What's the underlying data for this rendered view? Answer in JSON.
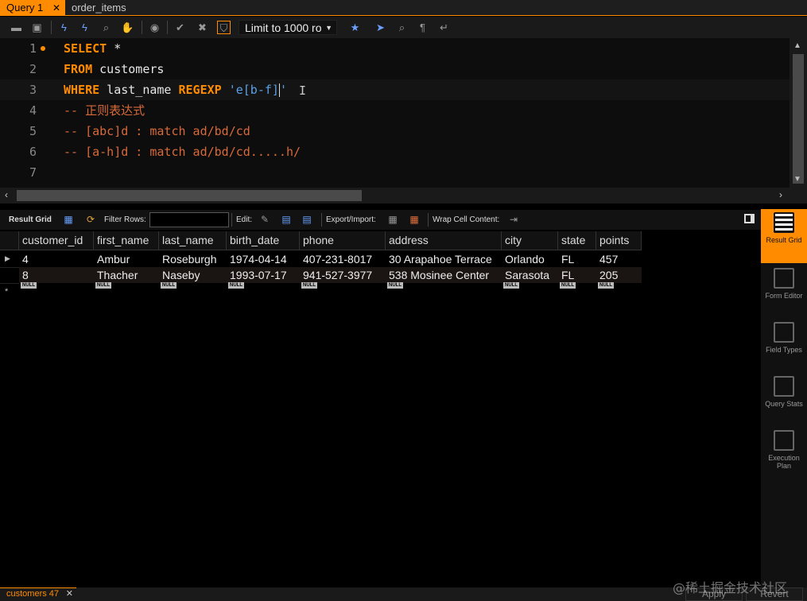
{
  "tabs": [
    {
      "label": "Query 1",
      "active": true
    },
    {
      "label": "order_items",
      "active": false
    }
  ],
  "toolbar": {
    "limit_label": "Limit to 1000 ro",
    "icons": [
      "open-folder-icon",
      "save-icon",
      "execute-icon",
      "execute-selection-icon",
      "explain-icon",
      "stop-icon",
      "toggle-autocommit-icon",
      "commit-icon",
      "rollback-icon",
      "toggle-error-icon",
      "bookmark-star-icon",
      "beautify-icon",
      "find-icon",
      "invisible-chars-icon",
      "wrap-icon"
    ]
  },
  "editor": {
    "line_numbers": [
      "1",
      "2",
      "3",
      "4",
      "5",
      "6",
      "7"
    ],
    "lines": [
      {
        "kw": "SELECT",
        "rest": " *"
      },
      {
        "kw": "FROM",
        "rest": " customers"
      },
      {
        "kw": "WHERE",
        "rest": " last_name ",
        "kw2": "REGEXP",
        "str": " 'e[b-f]",
        "str2": "'"
      },
      {
        "comment": "-- 正则表达式"
      },
      {
        "comment": "-- [abc]d : match ad/bd/cd"
      },
      {
        "comment": "-- [a-h]d : match ad/bd/cd.....h/"
      },
      {
        "comment": ""
      }
    ]
  },
  "result_toolbar": {
    "result_grid": "Result Grid",
    "filter_rows": "Filter Rows:",
    "edit": "Edit:",
    "export_import": "Export/Import:",
    "wrap_cell": "Wrap Cell Content:"
  },
  "grid": {
    "columns": [
      "customer_id",
      "first_name",
      "last_name",
      "birth_date",
      "phone",
      "address",
      "city",
      "state",
      "points"
    ],
    "rows": [
      [
        "4",
        "Ambur",
        "Roseburgh",
        "1974-04-14",
        "407-231-8017",
        "30 Arapahoe Terrace",
        "Orlando",
        "FL",
        "457"
      ],
      [
        "8",
        "Thacher",
        "Naseby",
        "1993-07-17",
        "941-527-3977",
        "538 Mosinee Center",
        "Sarasota",
        "FL",
        "205"
      ]
    ],
    "null_label": "NULL"
  },
  "side_panel": [
    {
      "label": "Result Grid",
      "active": true
    },
    {
      "label": "Form Editor",
      "active": false
    },
    {
      "label": "Field Types",
      "active": false
    },
    {
      "label": "Query Stats",
      "active": false
    },
    {
      "label": "Execution Plan",
      "active": false
    }
  ],
  "bottom": {
    "result_tab": "customers 47",
    "apply": "Apply",
    "revert": "Revert"
  },
  "watermark": "@稀土掘金技术社区",
  "colors": {
    "accent": "#ff8c00",
    "string": "#5aa0e6",
    "comment": "#d86a3a"
  }
}
